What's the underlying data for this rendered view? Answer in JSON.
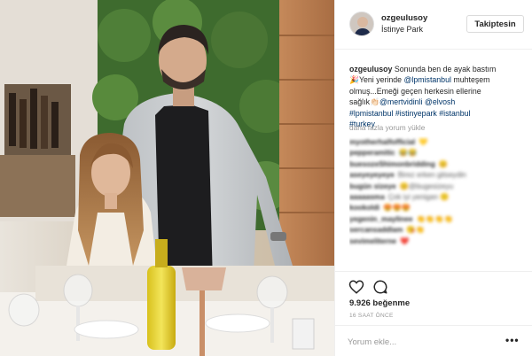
{
  "post": {
    "username": "ozgeulusoy",
    "location": "İstinye Park",
    "follow_label": "Takiptesin",
    "caption": {
      "username": "ozgeulusoy",
      "line1": "Sonunda ben de ayak bastım",
      "line2_prefix": "🎉Yeni yerinde ",
      "line2_mention": "@lpmistanbul",
      "line2_suffix": " muhteşem",
      "line3": "olmuş...Emeği geçen herkesin ellerine",
      "line4_prefix": "sağlık👏🏻",
      "mention_mert": "@mertvidinli",
      "mention_elvosh": "@elvosh",
      "tag_lpm": "#lpmistanbul",
      "tag_istinye": "#istinyepark",
      "tag_istanbul": "#istanbul",
      "tag_turkey": "#turkey"
    },
    "more_comments_label": "daha fazla yorum yükle",
    "comments": [
      {
        "user": "myotherhalfofficial",
        "text": "💛"
      },
      {
        "user": "pepperamitic",
        "text": "😂😂"
      },
      {
        "user": "buesozeShimonbridding",
        "text": "😊"
      },
      {
        "user": "aseyeyeyeye",
        "text": "Birez erken gitseydin"
      },
      {
        "user": "bugün sizeye",
        "text": "😊@bugesizeyu"
      },
      {
        "user": "aaaaasma",
        "text": "Çok iyi yenigan 🙂"
      },
      {
        "user": "kookoldi",
        "text": "😍😍😍"
      },
      {
        "user": "yegenin_maylinee",
        "text": "👏👏👏👏"
      },
      {
        "user": "sercansaddlam",
        "text": "😘👏"
      },
      {
        "user": "sevimeliterne",
        "text": "❤️"
      }
    ],
    "likes": "9.926 beğenme",
    "time": "16 SAAT ÖNCE",
    "comment_placeholder": "Yorum ekle...",
    "more_options_label": "•••"
  },
  "icons": {
    "like": "heart-outline-icon",
    "comment": "comment-bubble-icon"
  },
  "colors": {
    "link": "#003569",
    "follow_border": "#dbdbdb",
    "muted": "#999999"
  }
}
